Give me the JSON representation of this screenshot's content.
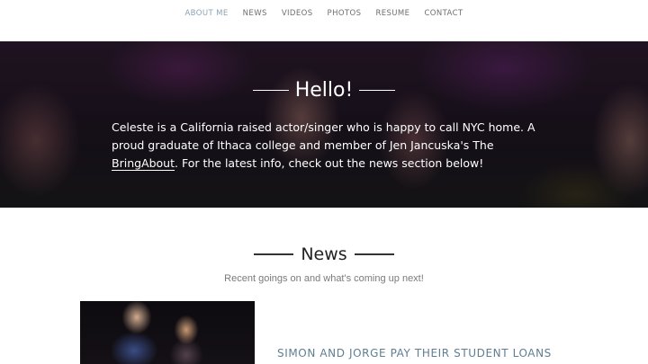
{
  "nav": {
    "items": [
      {
        "label": "ABOUT ME"
      },
      {
        "label": "NEWS"
      },
      {
        "label": "VIDEOS"
      },
      {
        "label": "PHOTOS"
      },
      {
        "label": "RESUME"
      },
      {
        "label": "CONTACT"
      }
    ],
    "active_color": "#8aa2b3"
  },
  "hero": {
    "title": "Hello!",
    "text_before_link": "Celeste is a California raised actor/singer who is happy to call NYC home. A proud graduate of Ithaca college and member of Jen Jancuska's The ",
    "link_text": "BringAbout",
    "text_after_link": ". For the latest info, check out the news section below!"
  },
  "news": {
    "heading": "News",
    "subtitle": "Recent goings on and what's coming up next!",
    "items": [
      {
        "title": "SIMON AND JORGE PAY THEIR STUDENT LOANS"
      }
    ]
  }
}
